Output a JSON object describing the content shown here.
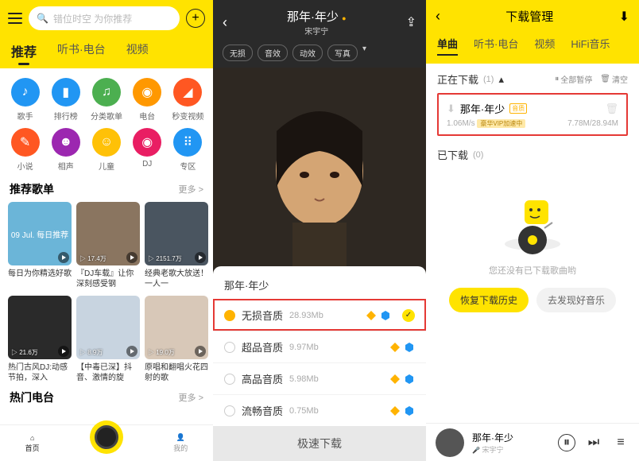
{
  "screen1": {
    "search_placeholder": "错位时空 为你推荐",
    "tabs": [
      "推荐",
      "听书·电台",
      "视频"
    ],
    "categories": [
      {
        "label": "歌手",
        "color": "#2196f3",
        "icon": "♪"
      },
      {
        "label": "排行榜",
        "color": "#2196f3",
        "icon": "▮"
      },
      {
        "label": "分类歌单",
        "color": "#4caf50",
        "icon": "♫"
      },
      {
        "label": "电台",
        "color": "#ff9800",
        "icon": "◉"
      },
      {
        "label": "秒变视频",
        "color": "#ff5722",
        "icon": "◢"
      },
      {
        "label": "小说",
        "color": "#ff5722",
        "icon": "✎"
      },
      {
        "label": "相声",
        "color": "#9c27b0",
        "icon": "☻"
      },
      {
        "label": "儿童",
        "color": "#ffc107",
        "icon": "☺"
      },
      {
        "label": "DJ",
        "color": "#e91e63",
        "icon": "◉"
      },
      {
        "label": "专区",
        "color": "#2196f3",
        "icon": "⠿"
      }
    ],
    "section1_title": "推荐歌单",
    "more": "更多 >",
    "playlists1": [
      {
        "title": "每日为你精选好歌",
        "count": "",
        "overlay": "09 Jul. 每日推荐",
        "bg": "#6bb5d8"
      },
      {
        "title": "『DJ车载』让你深刻感受钢",
        "count": "▷ 17.4万",
        "bg": "#8a7560"
      },
      {
        "title": "经典老歌大放送！一人一",
        "count": "▷ 2151.7万",
        "bg": "#4a5560"
      }
    ],
    "playlists2": [
      {
        "title": "热门古风DJ:动感节拍，深入",
        "count": "▷ 21.6万",
        "bg": "#2a2a2a"
      },
      {
        "title": "【中毒已深】抖音、激情的旋",
        "count": "▷ 8.9万",
        "bg": "#c8d4e0"
      },
      {
        "title": "原唱和翻唱火花四射的歌",
        "count": "▷ 19.0万",
        "bg": "#d8c8b8"
      }
    ],
    "section2_title": "热门电台",
    "nav": {
      "home": "首页",
      "mine": "我的"
    }
  },
  "screen2": {
    "title": "那年·年少",
    "artist": "宋宇宁",
    "chips": [
      "无损",
      "音效",
      "动效",
      "写真"
    ],
    "sheet_title": "那年·年少",
    "qualities": [
      {
        "name": "无损音质",
        "size": "28.93Mb",
        "selected": true,
        "vip": true
      },
      {
        "name": "超品音质",
        "size": "9.97Mb",
        "selected": false,
        "vip": true
      },
      {
        "name": "高品音质",
        "size": "5.98Mb",
        "selected": false,
        "vip": true
      },
      {
        "name": "流畅音质",
        "size": "0.75Mb",
        "selected": false,
        "vip": true
      }
    ],
    "download_btn": "极速下载"
  },
  "screen3": {
    "title": "下载管理",
    "tabs": [
      "单曲",
      "听书·电台",
      "视频",
      "HiFi音乐"
    ],
    "downloading_label": "正在下载",
    "downloading_count": "(1)",
    "pause_all": "全部暂停",
    "clear": "清空",
    "dl_item": {
      "name": "那年·年少",
      "speed": "1.06M/s",
      "vip_label": "豪华VIP加速中",
      "progress": "7.78M/28.94M"
    },
    "downloaded_label": "已下载",
    "downloaded_count": "(0)",
    "empty_text": "您还没有已下载歌曲哟",
    "btn_restore": "恢复下载历史",
    "btn_discover": "去发现好音乐",
    "player": {
      "title": "那年·年少",
      "artist": "宋宇宁"
    }
  }
}
